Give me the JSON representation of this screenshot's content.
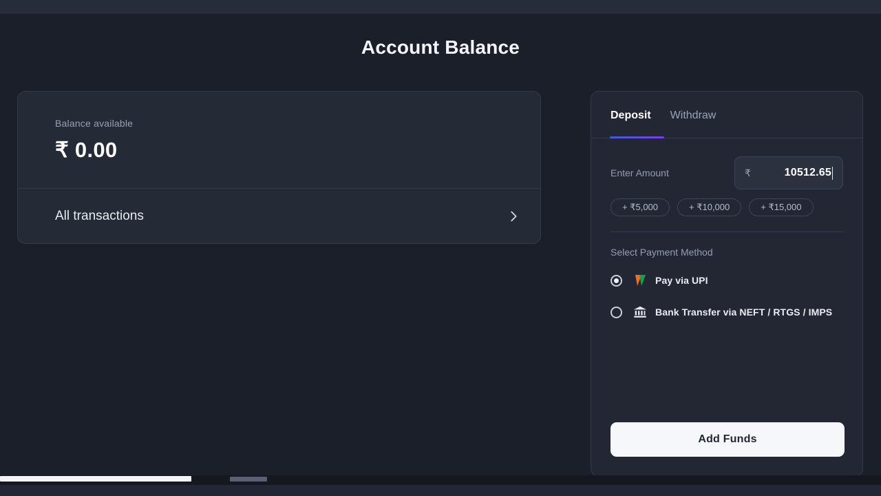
{
  "page": {
    "title": "Account Balance"
  },
  "balance_card": {
    "label": "Balance available",
    "amount": "₹ 0.00",
    "transactions_link": "All transactions",
    "chevron_icon": "chevron-right-icon"
  },
  "deposit_panel": {
    "tabs": [
      {
        "label": "Deposit",
        "active": true
      },
      {
        "label": "Withdraw",
        "active": false
      }
    ],
    "amount": {
      "label": "Enter Amount",
      "currency_symbol": "₹",
      "value": "10512.65",
      "placeholder": "0"
    },
    "quick_amounts": [
      {
        "label": "+ ₹5,000"
      },
      {
        "label": "+ ₹10,000"
      },
      {
        "label": "+ ₹15,000"
      }
    ],
    "payment_method": {
      "label": "Select Payment Method",
      "options": [
        {
          "label": "Pay via UPI",
          "icon": "upi-logo-icon",
          "selected": true
        },
        {
          "label": "Bank Transfer via NEFT / RTGS / IMPS",
          "icon": "bank-building-icon",
          "selected": false
        }
      ]
    },
    "submit": {
      "label": "Add Funds"
    }
  },
  "colors": {
    "page_background": "#1b1f2a",
    "card_background": "#252a37",
    "panel_background": "#232734",
    "border": "#343a4b",
    "text_primary": "#ffffff",
    "text_muted": "#959db0",
    "accent_gradient_start": "#3f5ed8",
    "accent_gradient_end": "#7b3cf0",
    "button_background": "#f6f7fb",
    "upi_orange": "#f07023",
    "upi_green": "#17a04a"
  }
}
